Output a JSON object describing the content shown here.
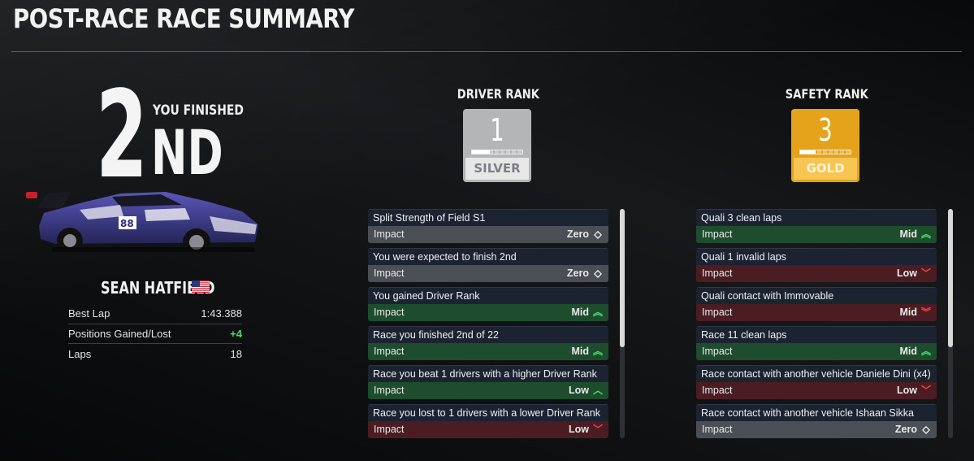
{
  "page": {
    "title": "POST-RACE RACE SUMMARY"
  },
  "result": {
    "position": "2",
    "finished_label": "YOU FINISHED",
    "ordinal": "ND"
  },
  "driver": {
    "name": "SEAN HATFIELD",
    "flag_icon": "us-flag-icon",
    "car_number": "88",
    "stats": [
      {
        "label": "Best Lap",
        "value": "1:43.388"
      },
      {
        "label": "Positions Gained/Lost",
        "value": "+4",
        "color": "#3ee26a"
      },
      {
        "label": "Laps",
        "value": "18"
      }
    ]
  },
  "driver_rank": {
    "heading": "DRIVER RANK",
    "value": "1",
    "tier": "SILVER",
    "progress": 0.35,
    "color": "#b3b5b7",
    "factors": [
      {
        "title": "Split Strength of Field S1",
        "impact_label": "Impact",
        "level": "Zero",
        "icon": "diamond-icon",
        "kind": "zero"
      },
      {
        "title": "You were expected to finish 2nd",
        "impact_label": "Impact",
        "level": "Zero",
        "icon": "diamond-icon",
        "kind": "zero"
      },
      {
        "title": "You gained Driver Rank",
        "impact_label": "Impact",
        "level": "Mid",
        "icon": "double-chevron-up-icon",
        "kind": "up"
      },
      {
        "title": "Race you finished 2nd of 22",
        "impact_label": "Impact",
        "level": "Mid",
        "icon": "double-chevron-up-icon",
        "kind": "up"
      },
      {
        "title": "Race you beat 1 drivers with a higher Driver Rank",
        "impact_label": "Impact",
        "level": "Low",
        "icon": "chevron-up-icon",
        "kind": "up"
      },
      {
        "title": "Race you lost to 1 drivers with a lower Driver Rank",
        "impact_label": "Impact",
        "level": "Low",
        "icon": "chevron-down-icon",
        "kind": "down"
      }
    ]
  },
  "safety_rank": {
    "heading": "SAFETY RANK",
    "value": "3",
    "tier": "GOLD",
    "progress": 0.3,
    "color": "#e5a31c",
    "factors": [
      {
        "title": "Quali 3 clean laps",
        "impact_label": "Impact",
        "level": "Mid",
        "icon": "double-chevron-up-icon",
        "kind": "up"
      },
      {
        "title": "Quali 1 invalid laps",
        "impact_label": "Impact",
        "level": "Low",
        "icon": "chevron-down-icon",
        "kind": "down"
      },
      {
        "title": "Quali contact with Immovable",
        "impact_label": "Impact",
        "level": "Mid",
        "icon": "double-chevron-down-icon",
        "kind": "down"
      },
      {
        "title": "Race 11 clean laps",
        "impact_label": "Impact",
        "level": "Mid",
        "icon": "double-chevron-up-icon",
        "kind": "up"
      },
      {
        "title": "Race contact with another vehicle Daniele Dini (x4)",
        "impact_label": "Impact",
        "level": "Low",
        "icon": "chevron-down-icon",
        "kind": "down"
      },
      {
        "title": "Race contact with another vehicle Ishaan Sikka",
        "impact_label": "Impact",
        "level": "Zero",
        "icon": "diamond-icon",
        "kind": "zero"
      }
    ]
  }
}
